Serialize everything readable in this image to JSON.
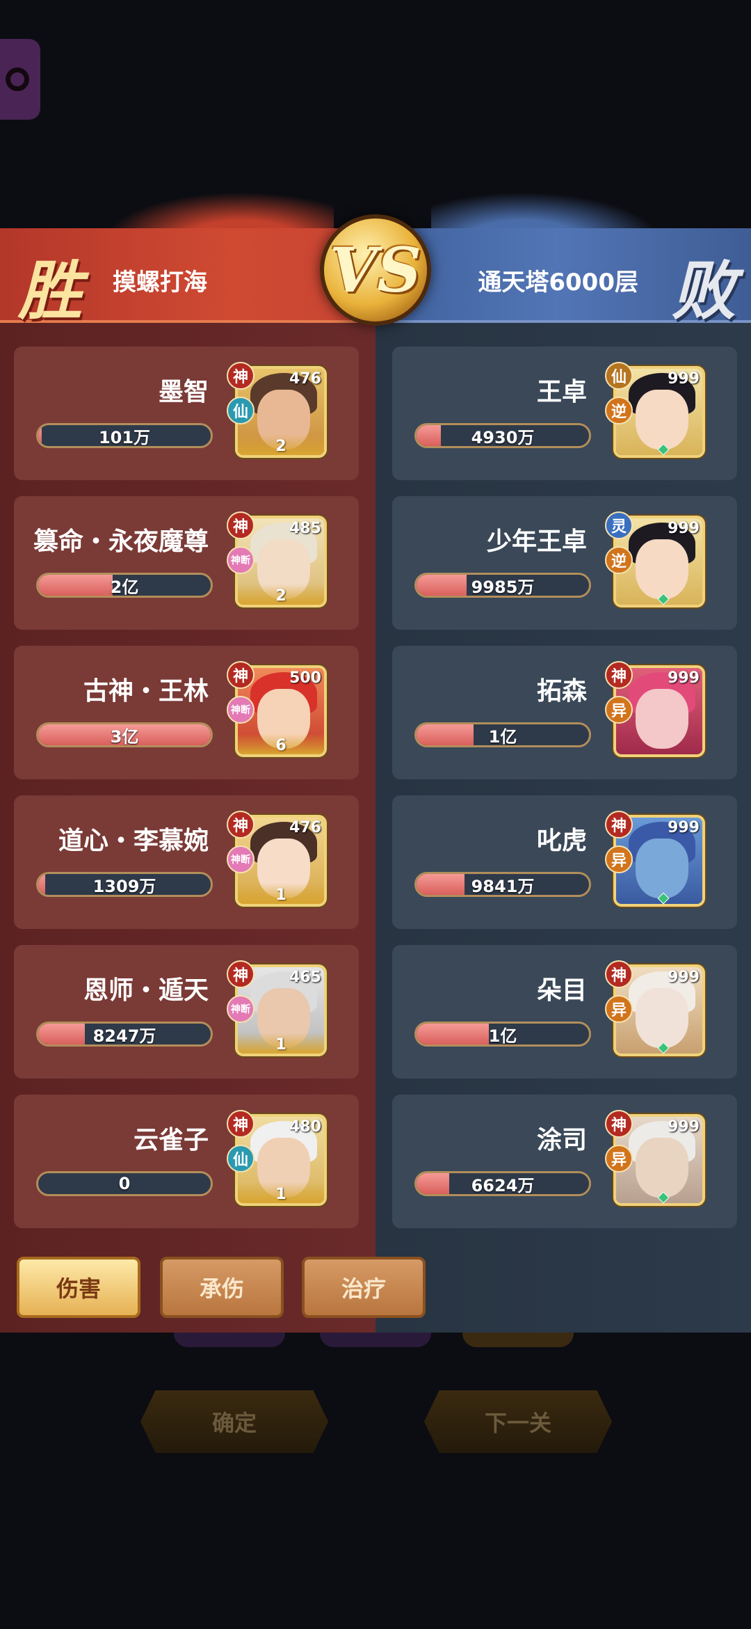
{
  "battle": {
    "win_label": "胜",
    "lose_label": "败",
    "vs_label": "VS",
    "left_team": "摸螺打海",
    "right_team": "通天塔6000层"
  },
  "left_heroes": [
    {
      "name": "墨智",
      "value": "101万",
      "level": "476",
      "star": "2",
      "tag1": "神",
      "tag2": "仙",
      "fill": 0.02
    },
    {
      "name": "篡命・永夜魔尊",
      "value": "2亿",
      "level": "485",
      "star": "2",
      "tag1": "神",
      "tag2": "神断",
      "fill": 0.43
    },
    {
      "name": "古神・王林",
      "value": "3亿",
      "level": "500",
      "star": "6",
      "tag1": "神",
      "tag2": "神断",
      "fill": 1.0
    },
    {
      "name": "道心・李慕婉",
      "value": "1309万",
      "level": "476",
      "star": "1",
      "tag1": "神",
      "tag2": "神断",
      "fill": 0.04
    },
    {
      "name": "恩师・遁天",
      "value": "8247万",
      "level": "465",
      "star": "1",
      "tag1": "神",
      "tag2": "神断",
      "fill": 0.27
    },
    {
      "name": "云雀子",
      "value": "0",
      "level": "480",
      "star": "1",
      "tag1": "神",
      "tag2": "仙",
      "fill": 0.0
    }
  ],
  "right_heroes": [
    {
      "name": "王卓",
      "value": "4930万",
      "level": "999",
      "tag1": "仙",
      "tag2": "逆",
      "fill": 0.14
    },
    {
      "name": "少年王卓",
      "value": "9985万",
      "level": "999",
      "tag1": "灵",
      "tag2": "逆",
      "fill": 0.29
    },
    {
      "name": "拓森",
      "value": "1亿",
      "level": "999",
      "tag1": "神",
      "tag2": "异",
      "fill": 0.33
    },
    {
      "name": "叱虎",
      "value": "9841万",
      "level": "999",
      "tag1": "神",
      "tag2": "异",
      "fill": 0.28
    },
    {
      "name": "朵目",
      "value": "1亿",
      "level": "999",
      "tag1": "神",
      "tag2": "异",
      "fill": 0.42
    },
    {
      "name": "涂司",
      "value": "6624万",
      "level": "999",
      "tag1": "神",
      "tag2": "异",
      "fill": 0.19
    }
  ],
  "stat_tabs": [
    "伤害",
    "承伤",
    "治疗"
  ],
  "bottom_buttons": {
    "confirm": "确定",
    "next": "下一关"
  },
  "colors": {
    "win_side": "#5c2222",
    "lose_side": "#283442",
    "bar_fill": "#e0706b",
    "gold": "#f0d27a"
  }
}
